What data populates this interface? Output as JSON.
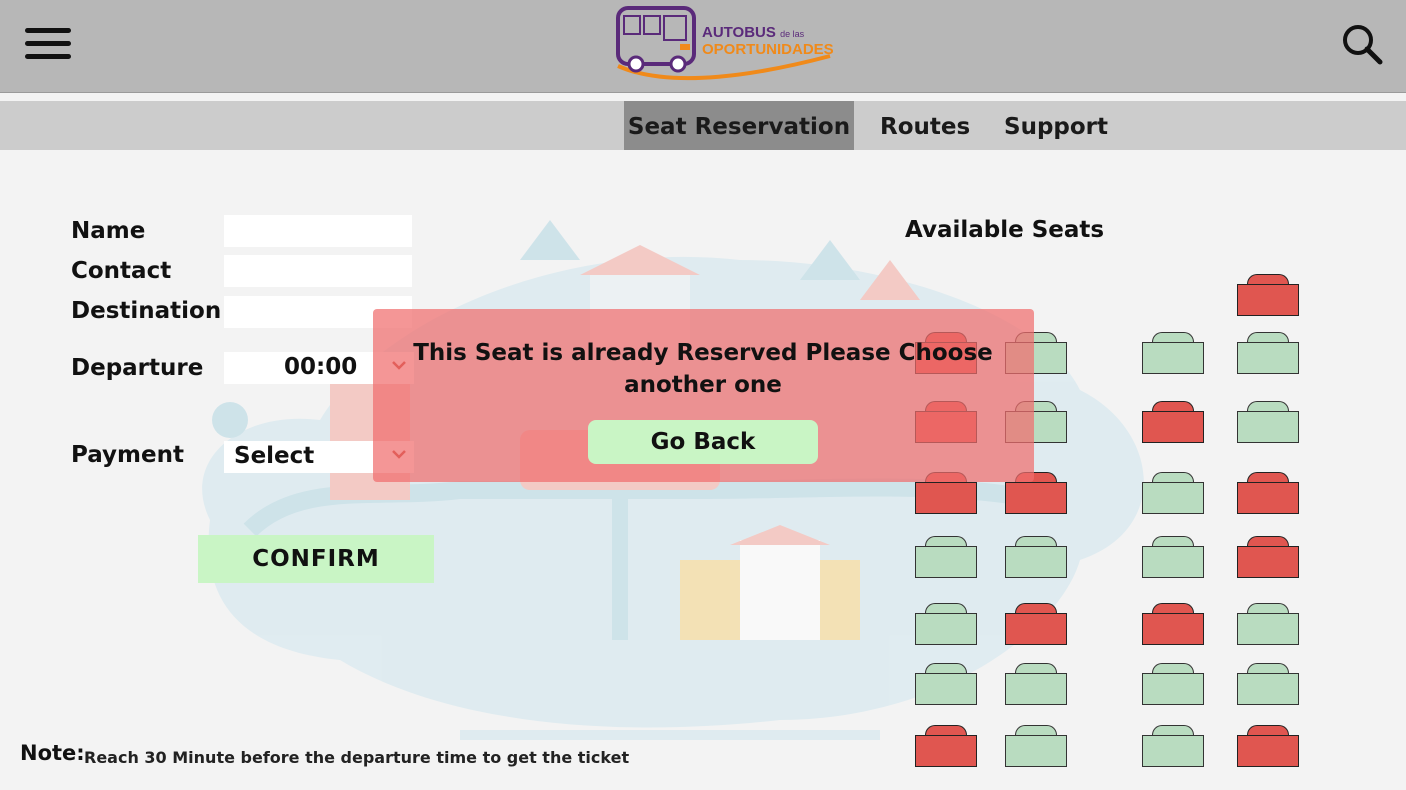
{
  "header": {
    "logo_line1": "AUTOBUS",
    "logo_line1_small": "de las",
    "logo_line2": "OPORTUNIDADES"
  },
  "nav": {
    "tabs": [
      {
        "label": "Seat Reservation",
        "active": true
      },
      {
        "label": "Routes",
        "active": false
      },
      {
        "label": "Support",
        "active": false
      }
    ]
  },
  "form": {
    "name_label": "Name",
    "name_value": "",
    "contact_label": "Contact",
    "contact_value": "",
    "destination_label": "Destination",
    "destination_value": "",
    "departure_label": "Departure",
    "departure_value": "00:00",
    "payment_label": "Payment",
    "payment_value": "Select",
    "confirm_label": "CONFIRM"
  },
  "note": {
    "label": "Note:",
    "text": "Reach 30 Minute before the departure time to get the ticket"
  },
  "seats": {
    "title": "Available Seats",
    "colors": {
      "free": "#b9dcc0",
      "taken": "#e05650"
    },
    "rows": [
      [
        "none",
        "none",
        "none",
        "taken"
      ],
      [
        "taken",
        "free",
        "free",
        "free"
      ],
      [
        "taken",
        "free",
        "taken",
        "free"
      ],
      [
        "taken",
        "taken",
        "free",
        "taken"
      ],
      [
        "free",
        "free",
        "free",
        "taken"
      ],
      [
        "free",
        "taken",
        "taken",
        "free"
      ],
      [
        "free",
        "free",
        "free",
        "free"
      ],
      [
        "taken",
        "free",
        "free",
        "taken"
      ]
    ]
  },
  "modal": {
    "message": "This Seat is already Reserved Please Choose another one",
    "button_label": "Go Back"
  }
}
